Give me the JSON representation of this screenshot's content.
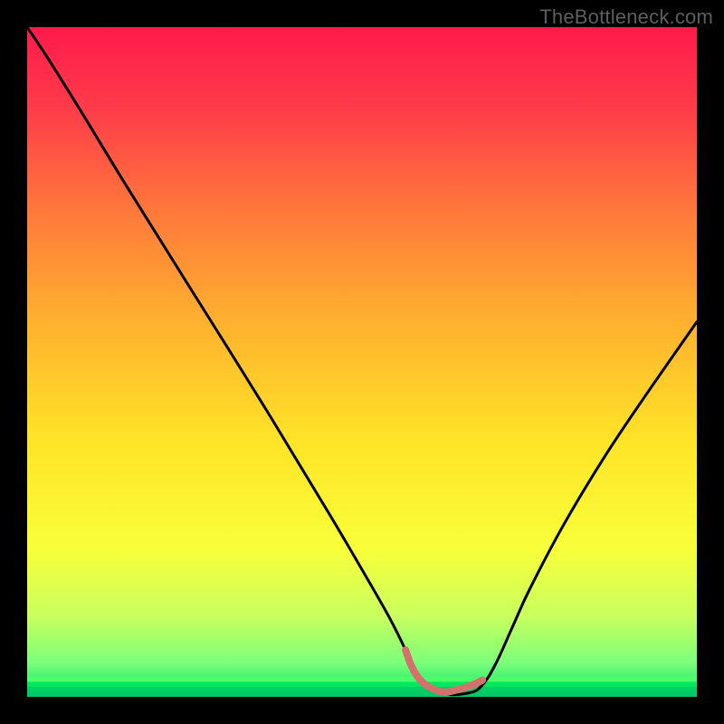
{
  "watermark": "TheBottleneck.com",
  "chart_data": {
    "type": "line",
    "title": "",
    "xlabel": "",
    "ylabel": "",
    "xlim": [
      0,
      100
    ],
    "ylim": [
      0,
      100
    ],
    "gradient_stops": [
      {
        "pos": 0.0,
        "color": "#ff1a4b"
      },
      {
        "pos": 0.12,
        "color": "#ff3b4a"
      },
      {
        "pos": 0.28,
        "color": "#ff7a3a"
      },
      {
        "pos": 0.45,
        "color": "#ffb42e"
      },
      {
        "pos": 0.62,
        "color": "#ffe427"
      },
      {
        "pos": 0.78,
        "color": "#f8ff3a"
      },
      {
        "pos": 0.88,
        "color": "#c8ff5e"
      },
      {
        "pos": 0.95,
        "color": "#7bff7a"
      },
      {
        "pos": 1.0,
        "color": "#00e06a"
      }
    ],
    "series": [
      {
        "name": "bottleneck-curve",
        "color": "#000000",
        "x": [
          0.0,
          3.0,
          8.0,
          15.0,
          25.0,
          35.0,
          45.0,
          50.0,
          54.0,
          56.5,
          58.0,
          62.0,
          66.0,
          68.0,
          70.0,
          72.5,
          75.0,
          80.0,
          86.0,
          92.0,
          100.0
        ],
        "values": [
          100.0,
          95.5,
          87.5,
          76.0,
          60.0,
          44.0,
          27.5,
          19.0,
          12.0,
          7.0,
          3.5,
          0.6,
          0.6,
          1.8,
          5.0,
          10.5,
          16.0,
          25.5,
          35.5,
          44.5,
          56.0
        ]
      },
      {
        "name": "valley-highlight",
        "color": "#d4716c",
        "x": [
          56.5,
          57.3,
          58.3,
          59.5,
          61.0,
          62.5,
          64.0,
          65.5,
          67.0,
          68.0
        ],
        "values": [
          7.0,
          4.8,
          3.0,
          1.8,
          1.0,
          0.7,
          1.0,
          1.4,
          2.0,
          2.5
        ]
      }
    ],
    "green_band": {
      "from": 0,
      "to": 3
    }
  }
}
